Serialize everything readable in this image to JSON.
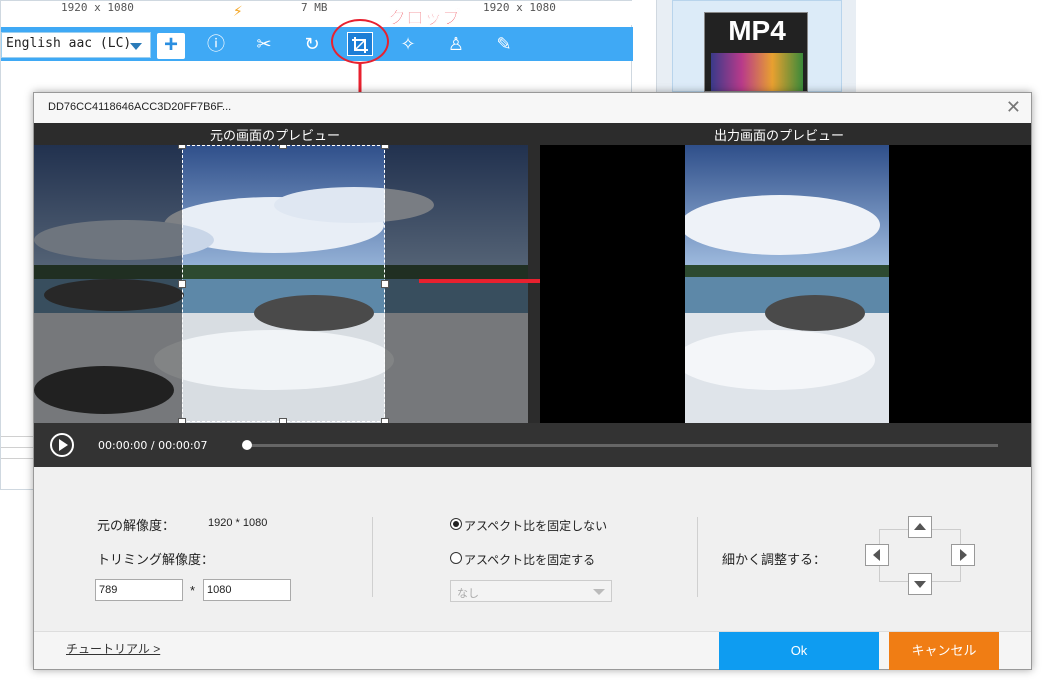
{
  "background_app": {
    "info_resolution_left": "1920 x 1080",
    "info_size": "7 MB",
    "info_resolution_right": "1920 x 1080",
    "audio_track": "English aac (LC)",
    "add_label": "+",
    "toolbar_icons": [
      "info-icon",
      "scissors-icon",
      "rotate-icon",
      "crop-icon",
      "effects-wand-icon",
      "watermark-stamp-icon",
      "subtitle-edit-icon"
    ],
    "format_thumbnail": "MP4"
  },
  "annotation": {
    "crop_label": "クロップ",
    "color": "#e8212f"
  },
  "dialog": {
    "title": "DD76CC4118646ACC3D20FF7B6F...",
    "close_label": "✕",
    "original_preview_label": "元の画面のプレビュー",
    "output_preview_label": "出力画面のプレビュー",
    "playback": {
      "current_time": "00:00:00",
      "separator": "/",
      "total_time": "00:00:07",
      "progress": 0
    },
    "settings": {
      "original_resolution_label": "元の解像度：",
      "original_resolution_value": "1920 * 1080",
      "trim_resolution_label": "トリミング解像度：",
      "trim_width": "789",
      "multiply_sign": "*",
      "trim_height": "1080",
      "aspect_free_label": "アスペクト比を固定しない",
      "aspect_fixed_label": "アスペクト比を固定する",
      "aspect_free_selected": true,
      "ratio_dropdown_value": "なし",
      "fine_adjust_label": "細かく調整する："
    },
    "footer": {
      "tutorial_link": "チュートリアル >",
      "ok_label": "Ok",
      "cancel_label": "キャンセル"
    }
  },
  "colors": {
    "accent_blue": "#0e9cf1",
    "toolbar_blue": "#3fa9f5",
    "cancel_orange": "#f07d14",
    "annotation_red": "#e8212f"
  }
}
